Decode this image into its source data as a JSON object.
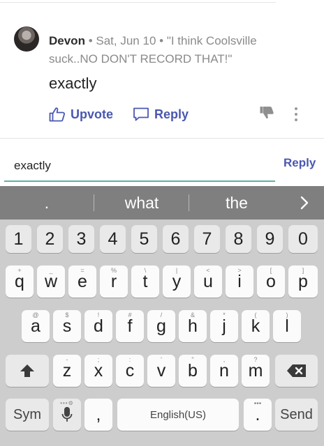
{
  "comment": {
    "author": "Devon",
    "date": "Sat, Jun 10",
    "quote": "\"I think Coolsville suck..NO DON'T RECORD THAT!\"",
    "body": "exactly",
    "upvote_label": "Upvote",
    "reply_label": "Reply"
  },
  "reply_box": {
    "value": "exactly",
    "send_label": "Reply"
  },
  "suggestions": [
    ".",
    "what",
    "the"
  ],
  "keyboard": {
    "numbers": [
      "1",
      "2",
      "3",
      "4",
      "5",
      "6",
      "7",
      "8",
      "9",
      "0"
    ],
    "row1": [
      "q",
      "w",
      "e",
      "r",
      "t",
      "y",
      "u",
      "i",
      "o",
      "p"
    ],
    "row1_sub": [
      "+",
      "_",
      "=",
      "%",
      "\\",
      "|",
      "<",
      ">",
      "[",
      "]"
    ],
    "row2": [
      "a",
      "s",
      "d",
      "f",
      "g",
      "h",
      "j",
      "k",
      "l"
    ],
    "row2_sub": [
      "@",
      "$",
      "!",
      "#",
      "/",
      "&",
      "*",
      "(",
      ")"
    ],
    "row3": [
      "z",
      "x",
      "c",
      "v",
      "b",
      "n",
      "m"
    ],
    "row3_sub": [
      "-",
      ";",
      ":",
      "'",
      "\"",
      ",",
      "?"
    ],
    "sym_label": "Sym",
    "comma_label": ",",
    "space_label": "English(US)",
    "period_label": ".",
    "send_label": "Send"
  },
  "colors": {
    "accent": "#4a57b0",
    "input_underline": "#5db3a3",
    "suggest_bar": "#7f7f7f",
    "keyboard_bg": "#cdcdcd"
  }
}
